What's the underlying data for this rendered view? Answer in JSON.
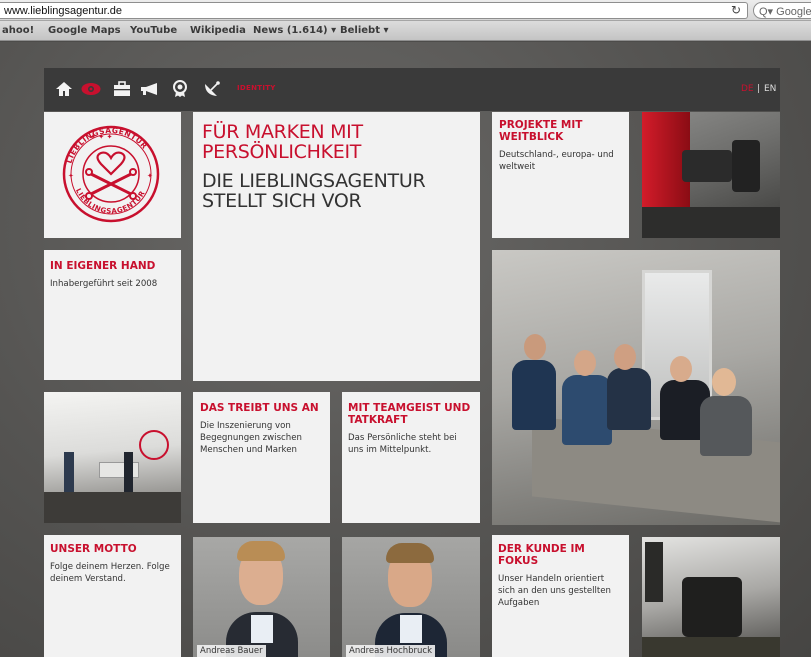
{
  "browser": {
    "url": "www.lieblingsagentur.de",
    "reload_icon": "↻",
    "search_placeholder": "Q▾ Google",
    "bookmarks": [
      "ahoo!",
      "Google Maps",
      "YouTube",
      "Wikipedia",
      "News (1.614) ▾",
      "Beliebt ▾"
    ]
  },
  "nav": {
    "icons": [
      "house-icon",
      "eye-icon",
      "briefcase-icon",
      "megaphone-icon",
      "award-icon",
      "satellite-icon"
    ],
    "active_label": "IDENTITY",
    "lang_de": "DE",
    "lang_sep": "|",
    "lang_en": "EN"
  },
  "logo": {
    "line1": "LIEBLINGSAGENTUR",
    "line2": "LIEBLINGSAGENTUR"
  },
  "intro": {
    "headline_red": "FÜR MARKEN MIT PERSÖNLICHKEIT",
    "headline_dark": "DIE LIEBLINGSAGENTUR STELLT SICH VOR"
  },
  "tiles": {
    "projekte": {
      "title": "PROJEKTE MIT WEITBLICK",
      "text": "Deutschland-, europa- und weltweit"
    },
    "eigener_hand": {
      "title": "IN EIGENER HAND",
      "text": "Inhabergeführt seit 2008"
    },
    "treibt": {
      "title": "DAS TREIBT UNS AN",
      "text": "Die Inszenierung von Begegnungen zwischen Menschen und Marken"
    },
    "teamgeist": {
      "title": "MIT TEAMGEIST UND TATKRAFT",
      "text": "Das Persönliche steht bei uns im Mittelpunkt."
    },
    "motto": {
      "title": "UNSER MOTTO",
      "text": "Folge deinem Herzen. Folge deinem Verstand."
    },
    "kunde": {
      "title": "DER KUNDE IM FOKUS",
      "text": "Unser Handeln orientiert sich an den uns gestellten Aufgaben"
    }
  },
  "portraits": {
    "bauer": "Andreas Bauer",
    "hochbruck": "Andreas Hochbruck"
  },
  "colors": {
    "accent": "#c8102e",
    "tile_bg": "#f2f2f2",
    "nav_bg": "#3a3a3a"
  }
}
